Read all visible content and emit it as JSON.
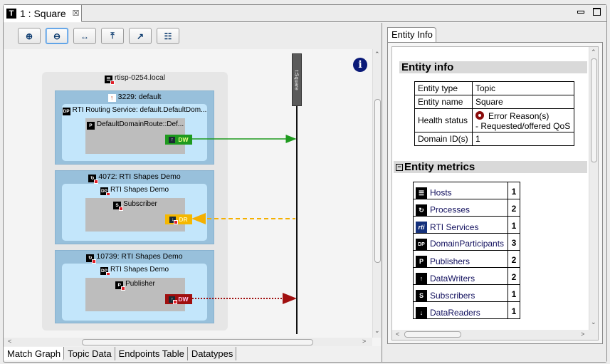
{
  "editor_tab": {
    "icon": "T",
    "title": "1 : Square",
    "close_icon": "☒"
  },
  "window_controls": {
    "minimize": "minimize",
    "maximize": "maximize"
  },
  "toolbar": {
    "buttons": [
      {
        "name": "zoom-in",
        "glyph": "⊕"
      },
      {
        "name": "zoom-out",
        "glyph": "⊖"
      },
      {
        "name": "fit-width",
        "glyph": "↔"
      },
      {
        "name": "move-top",
        "glyph": "⤒"
      },
      {
        "name": "export",
        "glyph": "↗"
      },
      {
        "name": "layout",
        "glyph": "☷"
      }
    ]
  },
  "graph": {
    "host": {
      "label": "rtisp-0254.local"
    },
    "processes": [
      {
        "label": "3229: default",
        "participant": "RTI Routing Service: default.DefaultDom...",
        "group": "DefaultDomainRoute::Def...",
        "endpoint": {
          "label": "DW",
          "kind": "writer",
          "color": "#1e9a1e",
          "text_color": "#eaff8a"
        }
      },
      {
        "label": "4072: RTI Shapes Demo",
        "participant": "RTI Shapes Demo",
        "group": "Subscriber",
        "endpoint": {
          "label": "DR",
          "kind": "reader",
          "color": "#f5b800",
          "text_color": "#fff3b0"
        }
      },
      {
        "label": "10739: RTI Shapes Demo",
        "participant": "RTI Shapes Demo",
        "group": "Publisher",
        "endpoint": {
          "label": "DW",
          "kind": "writer",
          "color": "#a00f0f",
          "text_color": "#ffc8f0"
        }
      }
    ],
    "topic": {
      "label": "t:Square"
    },
    "info_icon": "i"
  },
  "bottom_tabs": [
    "Match Graph",
    "Topic Data",
    "Endpoints Table",
    "Datatypes"
  ],
  "entity_panel": {
    "tab_label": "Entity Info",
    "info_heading": "Entity info",
    "info_rows": [
      {
        "key": "Entity type",
        "value": "Topic"
      },
      {
        "key": "Entity name",
        "value": "Square"
      },
      {
        "key": "Health status",
        "value": "Error Reason(s)",
        "detail": "- Requested/offered QoS"
      },
      {
        "key": "Domain ID(s)",
        "value": "1"
      }
    ],
    "metrics_heading": "Entity metrics",
    "collapse_glyph": "−",
    "metrics": [
      {
        "icon": "☰",
        "label": "Hosts",
        "count": "1"
      },
      {
        "icon": "↻",
        "label": "Processes",
        "count": "2"
      },
      {
        "icon": "rti",
        "label": "RTI Services",
        "count": "1"
      },
      {
        "icon": "DP",
        "label": "DomainParticipants",
        "count": "3"
      },
      {
        "icon": "P",
        "label": "Publishers",
        "count": "2"
      },
      {
        "icon": "↑",
        "label": "DataWriters",
        "count": "2"
      },
      {
        "icon": "S",
        "label": "Subscribers",
        "count": "1"
      },
      {
        "icon": "↓",
        "label": "DataReaders",
        "count": "1"
      }
    ]
  }
}
